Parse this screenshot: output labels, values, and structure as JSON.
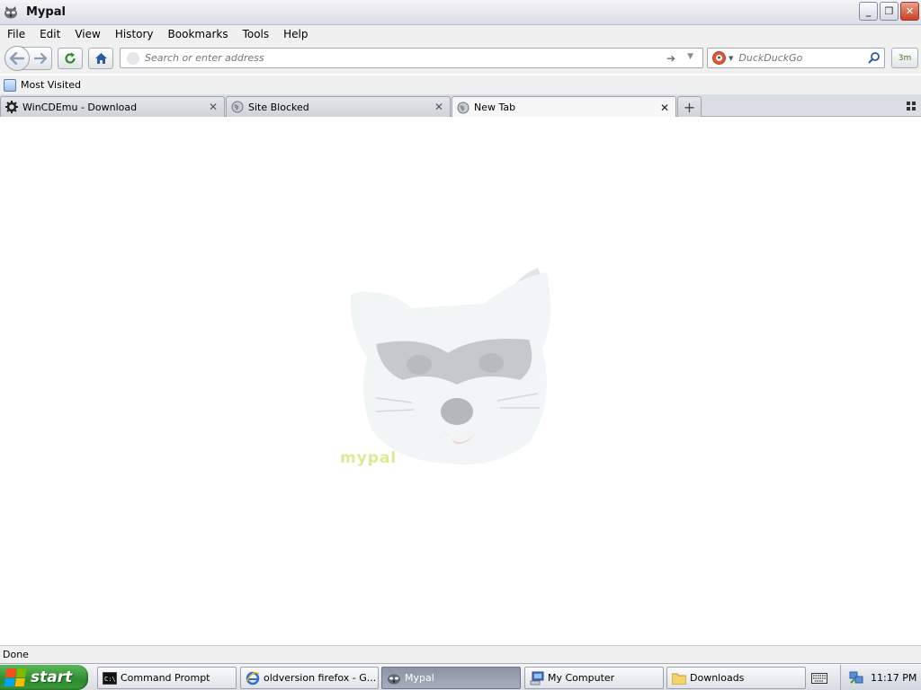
{
  "window": {
    "title": "Mypal"
  },
  "menu": {
    "items": [
      "File",
      "Edit",
      "View",
      "History",
      "Bookmarks",
      "Tools",
      "Help"
    ]
  },
  "toolbar": {
    "url_placeholder": "Search or enter address",
    "search_engine": "DuckDuckGo",
    "search_placeholder": "DuckDuckGo",
    "extension_badge": "3m"
  },
  "bookmarks": {
    "items": [
      {
        "label": "Most Visited"
      }
    ]
  },
  "tabs": [
    {
      "title": "WinCDEmu - Download",
      "icon": "gear-icon",
      "active": false
    },
    {
      "title": "Site Blocked",
      "icon": "globe-icon",
      "active": false
    },
    {
      "title": "New Tab",
      "icon": "globe-icon",
      "active": true
    }
  ],
  "content": {
    "mascot_label": "mypal"
  },
  "status": {
    "text": "Done"
  },
  "taskbar": {
    "start_label": "start",
    "tasks": [
      {
        "label": "Command Prompt",
        "icon": "cmd-icon",
        "active": false
      },
      {
        "label": "oldversion firefox - G...",
        "icon": "ie-icon",
        "active": false
      },
      {
        "label": "Mypal",
        "icon": "mypal-icon",
        "active": true
      },
      {
        "label": "My Computer",
        "icon": "computer-icon",
        "active": false
      },
      {
        "label": "Downloads",
        "icon": "folder-icon",
        "active": false
      }
    ],
    "clock": "11:17 PM"
  },
  "colors": {
    "accent": "#2e8b2e",
    "close_red": "#c84125",
    "active_task": "#8c93a3"
  }
}
